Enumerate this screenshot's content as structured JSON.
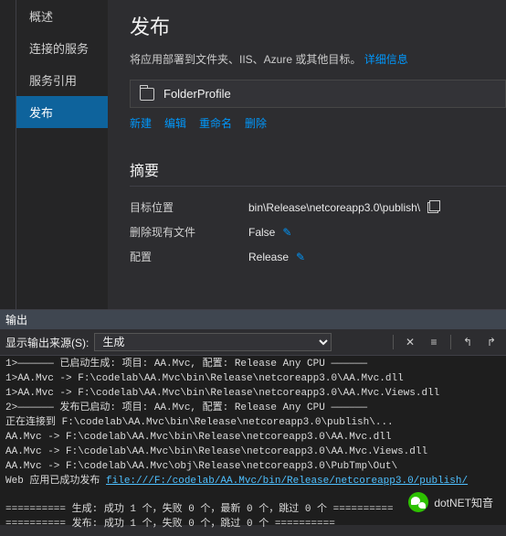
{
  "sidebar": {
    "items": [
      {
        "label": "概述"
      },
      {
        "label": "连接的服务"
      },
      {
        "label": "服务引用"
      },
      {
        "label": "发布"
      }
    ]
  },
  "page": {
    "title": "发布",
    "description": "将应用部署到文件夹、IIS、Azure 或其他目标。",
    "more_info": "详细信息"
  },
  "profile": {
    "name": "FolderProfile"
  },
  "actions": {
    "new": "新建",
    "edit": "编辑",
    "rename": "重命名",
    "delete": "删除"
  },
  "summary": {
    "title": "摘要",
    "rows": {
      "target_label": "目标位置",
      "target_value": "bin\\Release\\netcoreapp3.0\\publish\\",
      "delete_label": "删除现有文件",
      "delete_value": "False",
      "config_label": "配置",
      "config_value": "Release"
    }
  },
  "output": {
    "panel_title": "输出",
    "source_label": "显示输出来源(S):",
    "source_value": "生成",
    "lines": [
      "1>—————— 已启动生成: 项目: AA.Mvc, 配置: Release Any CPU ——————",
      "1>AA.Mvc -> F:\\codelab\\AA.Mvc\\bin\\Release\\netcoreapp3.0\\AA.Mvc.dll",
      "1>AA.Mvc -> F:\\codelab\\AA.Mvc\\bin\\Release\\netcoreapp3.0\\AA.Mvc.Views.dll",
      "2>—————— 发布已启动: 项目: AA.Mvc, 配置: Release Any CPU ——————",
      "正在连接到 F:\\codelab\\AA.Mvc\\bin\\Release\\netcoreapp3.0\\publish\\...",
      "AA.Mvc -> F:\\codelab\\AA.Mvc\\bin\\Release\\netcoreapp3.0\\AA.Mvc.dll",
      "AA.Mvc -> F:\\codelab\\AA.Mvc\\bin\\Release\\netcoreapp3.0\\AA.Mvc.Views.dll",
      "AA.Mvc -> F:\\codelab\\AA.Mvc\\obj\\Release\\netcoreapp3.0\\PubTmp\\Out\\"
    ],
    "publish_success_prefix": "Web 应用已成功发布 ",
    "publish_link": "file:///F:/codelab/AA.Mvc/bin/Release/netcoreapp3.0/publish/",
    "footer1": "========== 生成: 成功 1 个，失败 0 个，最新 0 个，跳过 0 个 ==========",
    "footer2": "========== 发布: 成功 1 个，失败 0 个，跳过 0 个 =========="
  },
  "watermark": {
    "text": "dotNET知音"
  }
}
